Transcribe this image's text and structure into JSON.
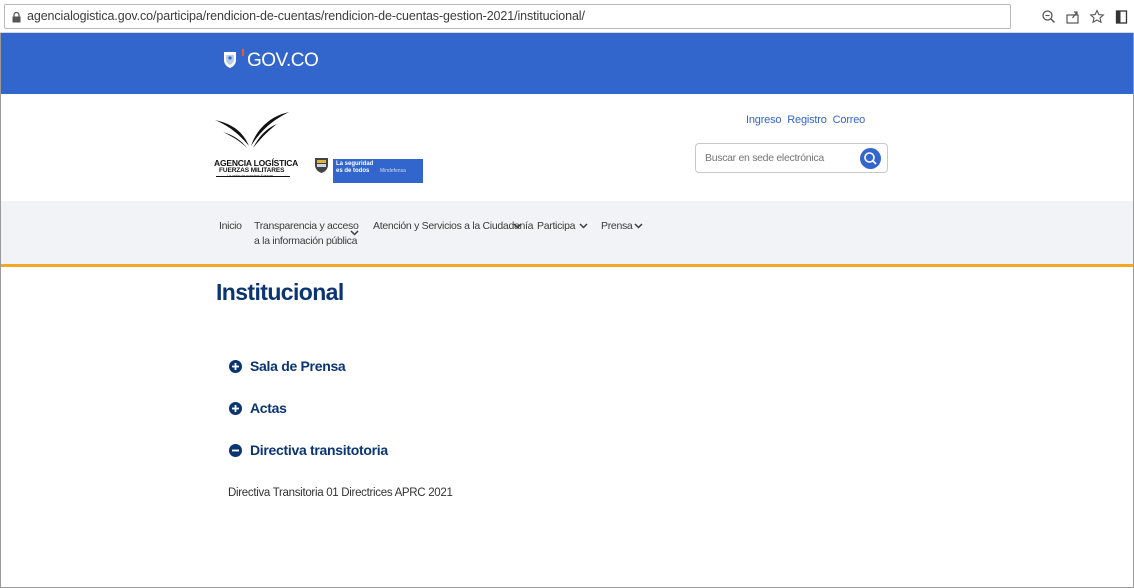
{
  "browser": {
    "url": "agencialogistica.gov.co/participa/rendicion-de-cuentas/rendicion-de-cuentas-gestion-2021/institucional/",
    "icons": [
      "lock-icon",
      "zoom-icon",
      "share-icon",
      "bookmark-star-icon",
      "sidebar-icon"
    ]
  },
  "govbar": {
    "label": "GOV.CO",
    "color": "#3366cc"
  },
  "header": {
    "logo": {
      "line1": "AGENCIA LOGÍSTICA",
      "line2": "FUERZAS MILITARES",
      "tagline": "La unión de nuestras Fuerzas"
    },
    "mindefensa": {
      "slogan": "La seguridad es de todos",
      "ministry": "Mindefensa"
    },
    "links": [
      "Ingreso",
      "Registro",
      "Correo"
    ],
    "search": {
      "placeholder": "Buscar en sede electrónica"
    }
  },
  "nav": {
    "items": [
      {
        "label": "Inicio"
      },
      {
        "label_line1": "Transparencia y acceso",
        "label_line2": "a la información pública"
      },
      {
        "label": "Atención y Servicios a la Ciudadanía"
      },
      {
        "label": "Participa"
      },
      {
        "label": "Prensa"
      }
    ],
    "accent": "#f5a623"
  },
  "main": {
    "title": "Institucional",
    "accordion": [
      {
        "label": "Sala de Prensa",
        "state": "collapsed"
      },
      {
        "label": "Actas",
        "state": "collapsed"
      },
      {
        "label": "Directiva transitotoria",
        "state": "expanded"
      }
    ],
    "expanded_content": {
      "link": "Directiva Transitoria 01 Directrices APRC 2021"
    },
    "title_color": "#0a3472"
  }
}
